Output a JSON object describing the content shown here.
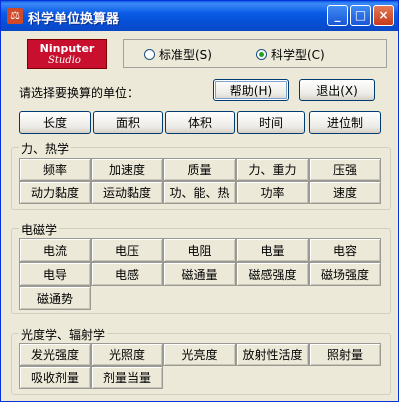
{
  "window": {
    "title": "科学单位换算器",
    "controls": {
      "min": "_",
      "max": "□",
      "close": "×"
    }
  },
  "logo": {
    "line1": "Ninputer",
    "line2": "Studio"
  },
  "mode": {
    "options": [
      {
        "label": "标准型(S)",
        "selected": false
      },
      {
        "label": "科学型(C)",
        "selected": true
      }
    ]
  },
  "prompt": "请选择要换算的单位：",
  "buttons": {
    "help": "帮助(H)",
    "exit": "退出(X)"
  },
  "basic_units": [
    "长度",
    "面积",
    "体积",
    "时间",
    "进位制"
  ],
  "groups": [
    {
      "title": "力、热学",
      "rows": [
        [
          "频率",
          "加速度",
          "质量",
          "力、重力",
          "压强"
        ],
        [
          "动力黏度",
          "运动黏度",
          "功、能、热",
          "功率",
          "速度"
        ]
      ]
    },
    {
      "title": "电磁学",
      "rows": [
        [
          "电流",
          "电压",
          "电阻",
          "电量",
          "电容"
        ],
        [
          "电导",
          "电感",
          "磁通量",
          "磁感强度",
          "磁场强度"
        ],
        [
          "磁通势"
        ]
      ]
    },
    {
      "title": "光度学、辐射学",
      "rows": [
        [
          "发光强度",
          "光照度",
          "光亮度",
          "放射性活度",
          "照射量"
        ],
        [
          "吸收剂量",
          "剂量当量"
        ]
      ]
    }
  ]
}
